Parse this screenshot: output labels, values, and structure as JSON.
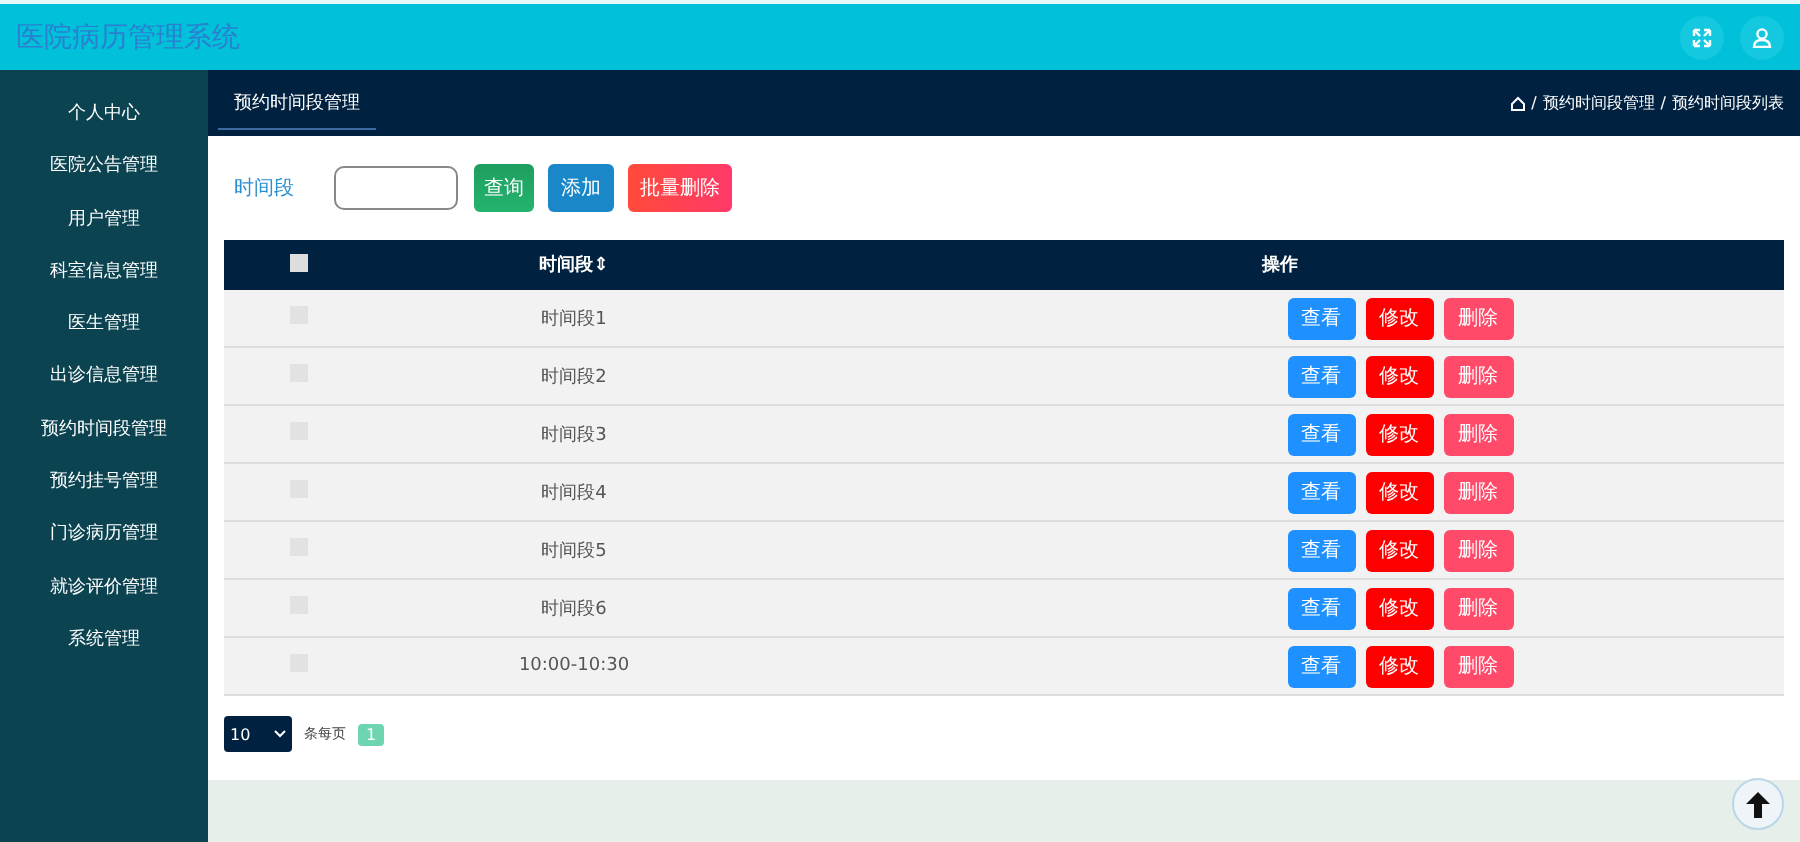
{
  "header": {
    "title": "医院病历管理系统"
  },
  "sidebar": {
    "items": [
      {
        "label": "个人中心"
      },
      {
        "label": "医院公告管理"
      },
      {
        "label": "用户管理"
      },
      {
        "label": "科室信息管理"
      },
      {
        "label": "医生管理"
      },
      {
        "label": "出诊信息管理"
      },
      {
        "label": "预约时间段管理"
      },
      {
        "label": "预约挂号管理"
      },
      {
        "label": "门诊病历管理"
      },
      {
        "label": "就诊评价管理"
      },
      {
        "label": "系统管理"
      }
    ]
  },
  "tab": {
    "label": "预约时间段管理"
  },
  "breadcrumb": [
    {
      "separator": "/",
      "label": "预约时间段管理"
    },
    {
      "separator": "/",
      "label": "预约时间段列表"
    }
  ],
  "search": {
    "label": "时间段",
    "buttons": [
      {
        "label": "查询",
        "kind": "query"
      },
      {
        "label": "添加",
        "kind": "add"
      },
      {
        "label": "批量删除",
        "kind": "delete"
      }
    ]
  },
  "table": {
    "select_all_checked": false,
    "columns": [
      "时间段",
      "操作"
    ],
    "sort_mark": "⇕",
    "rows": [
      {
        "time": "时间段1",
        "checked": false,
        "actions": [
          {
            "label": "查看",
            "kind": "view"
          },
          {
            "label": "修改",
            "kind": "edit"
          },
          {
            "label": "删除",
            "kind": "remove"
          }
        ]
      },
      {
        "time": "时间段2",
        "checked": false,
        "actions": [
          {
            "label": "查看",
            "kind": "view"
          },
          {
            "label": "修改",
            "kind": "edit"
          },
          {
            "label": "删除",
            "kind": "remove"
          }
        ]
      },
      {
        "time": "时间段3",
        "checked": false,
        "actions": [
          {
            "label": "查看",
            "kind": "view"
          },
          {
            "label": "修改",
            "kind": "edit"
          },
          {
            "label": "删除",
            "kind": "remove"
          }
        ]
      },
      {
        "time": "时间段4",
        "checked": false,
        "actions": [
          {
            "label": "查看",
            "kind": "view"
          },
          {
            "label": "修改",
            "kind": "edit"
          },
          {
            "label": "删除",
            "kind": "remove"
          }
        ]
      },
      {
        "time": "时间段5",
        "checked": false,
        "actions": [
          {
            "label": "查看",
            "kind": "view"
          },
          {
            "label": "修改",
            "kind": "edit"
          },
          {
            "label": "删除",
            "kind": "remove"
          }
        ]
      },
      {
        "time": "时间段6",
        "checked": false,
        "actions": [
          {
            "label": "查看",
            "kind": "view"
          },
          {
            "label": "修改",
            "kind": "edit"
          },
          {
            "label": "删除",
            "kind": "remove"
          }
        ]
      },
      {
        "time": "10:00-10:30",
        "checked": false,
        "actions": [
          {
            "label": "查看",
            "kind": "view"
          },
          {
            "label": "修改",
            "kind": "edit"
          },
          {
            "label": "删除",
            "kind": "remove"
          }
        ]
      }
    ]
  },
  "pagination": {
    "page_size": "10",
    "per_page_label": "条每页",
    "pages": [
      {
        "label": "1",
        "selected": true
      }
    ]
  }
}
